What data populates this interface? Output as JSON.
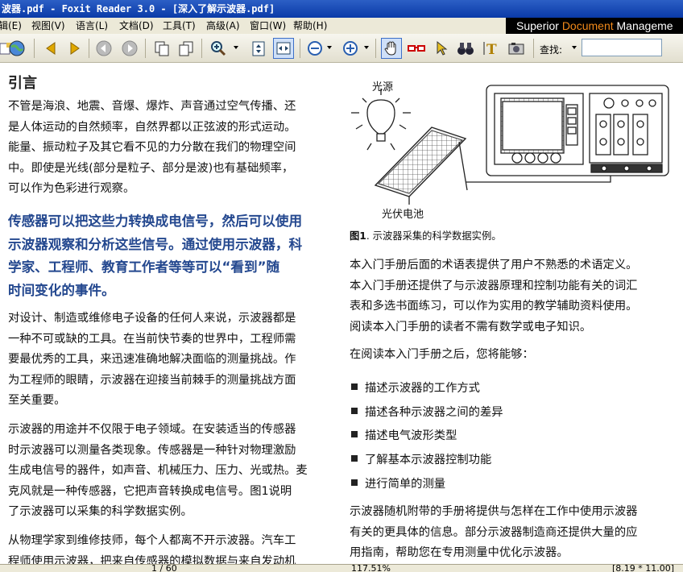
{
  "window": {
    "title": "波器.pdf - Foxit Reader 3.0 - [深入了解示波器.pdf]"
  },
  "menu": [
    "辑(E)",
    "视图(V)",
    "语言(L)",
    "文档(D)",
    "工具(T)",
    "高级(A)",
    "窗口(W)",
    "帮助(H)"
  ],
  "brand": {
    "part1": "Superior ",
    "part2": "Document",
    "part3": " Manageme"
  },
  "toolbar": {
    "find_label": "查找:",
    "find_value": ""
  },
  "statusbar": {
    "page": "1 / 60",
    "zoom": "117.51%",
    "size": "[8.19 * 11.00]"
  },
  "doc": {
    "heading": "引言",
    "para1": [
      "不管是海浪、地震、音爆、爆炸、声音通过空气传播、还",
      "是人体运动的自然频率，自然界都以正弦波的形式运动。",
      "能量、振动粒子及其它看不见的力分散在我们的物理空间",
      "中。即使是光线(部分是粒子、部分是波)也有基础频率，",
      "可以作为色彩进行观察。"
    ],
    "highlight": [
      "传感器可以把这些力转换成电信号，然后可以使用",
      "示波器观察和分析这些信号。通过使用示波器，科",
      "学家、工程师、教育工作者等等可以“看到”随",
      "时间变化的事件。"
    ],
    "para2": [
      "对设计、制造或维修电子设备的任何人来说，示波器都是",
      "一种不可或缺的工具。在当前快节奏的世界中，工程师需",
      "要最优秀的工具，来迅速准确地解决面临的测量挑战。作",
      "为工程师的眼睛，示波器在迎接当前棘手的测量挑战方面",
      "至关重要。"
    ],
    "para3": [
      "示波器的用途并不仅限于电子领域。在安装适当的传感器",
      "时示波器可以测量各类现象。传感器是一种针对物理激励",
      "生成电信号的器件，如声音、机械压力、压力、光或热。麦",
      "克风就是一种传感器，它把声音转换成电信号。图1说明",
      "了示波器可以采集的科学数据实例。"
    ],
    "para4": [
      "从物理学家到维修技师，每个人都离不开示波器。汽车工",
      "程师使用示波器，把来自传感器的模拟数据与来自发动机"
    ],
    "figure": {
      "label_light": "光源",
      "label_panel": "光伏电池",
      "caption_num": "图1",
      "caption_text": ". 示波器采集的科学数据实例。"
    },
    "right_para1": [
      "本入门手册后面的术语表提供了用户不熟悉的术语定义。",
      "本入门手册还提供了与示波器原理和控制功能有关的词汇",
      "表和多选书面练习，可以作为实用的教学辅助资料使用。",
      "阅读本入门手册的读者不需有数学或电子知识。"
    ],
    "right_para2": "在阅读本入门手册之后，您将能够：",
    "bullets": [
      "描述示波器的工作方式",
      "描述各种示波器之间的差异",
      "描述电气波形类型",
      "了解基本示波器控制功能",
      "进行简单的测量"
    ],
    "right_para3": [
      "示波器随机附带的手册将提供与怎样在工作中使用示波器",
      "有关的更具体的信息。部分示波器制造商还提供大量的应",
      "用指南，帮助您在专用测量中优化示波器。"
    ]
  }
}
